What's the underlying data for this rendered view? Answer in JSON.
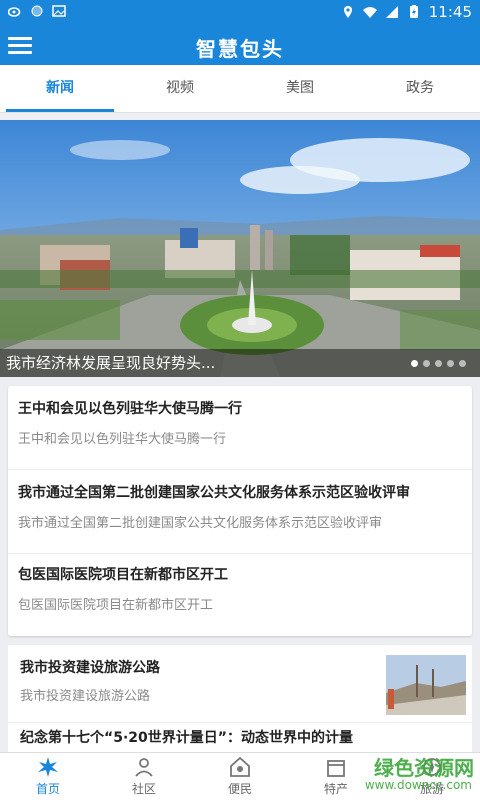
{
  "status_bar": {
    "time": "11:45"
  },
  "app": {
    "title": "智慧包头"
  },
  "tabs": [
    {
      "label": "新闻"
    },
    {
      "label": "视频"
    },
    {
      "label": "美图"
    },
    {
      "label": "政务"
    }
  ],
  "banner": {
    "caption": "我市经济林发展呈现良好势头..."
  },
  "news": [
    {
      "title": "王中和会见以色列驻华大使马腾一行",
      "summary": "王中和会见以色列驻华大使马腾一行"
    },
    {
      "title": "我市通过全国第二批创建国家公共文化服务体系示范区验收评审",
      "summary": "我市通过全国第二批创建国家公共文化服务体系示范区验收评审"
    },
    {
      "title": "包医国际医院项目在新都市区开工",
      "summary": "包医国际医院项目在新都市区开工"
    }
  ],
  "news2": [
    {
      "title": "我市投资建设旅游公路",
      "summary": "我市投资建设旅游公路"
    },
    {
      "title": "纪念第十七个“5·20世界计量日”：动态世界中的计量"
    }
  ],
  "bottom_nav": [
    {
      "label": "首页"
    },
    {
      "label": "社区"
    },
    {
      "label": "便民"
    },
    {
      "label": "特产"
    },
    {
      "label": "旅游"
    }
  ],
  "watermark": {
    "name": "绿色资源网",
    "url": "www.downcc.com"
  },
  "colors": {
    "accent": "#1a86d9",
    "watermark": "#3aa83a"
  }
}
